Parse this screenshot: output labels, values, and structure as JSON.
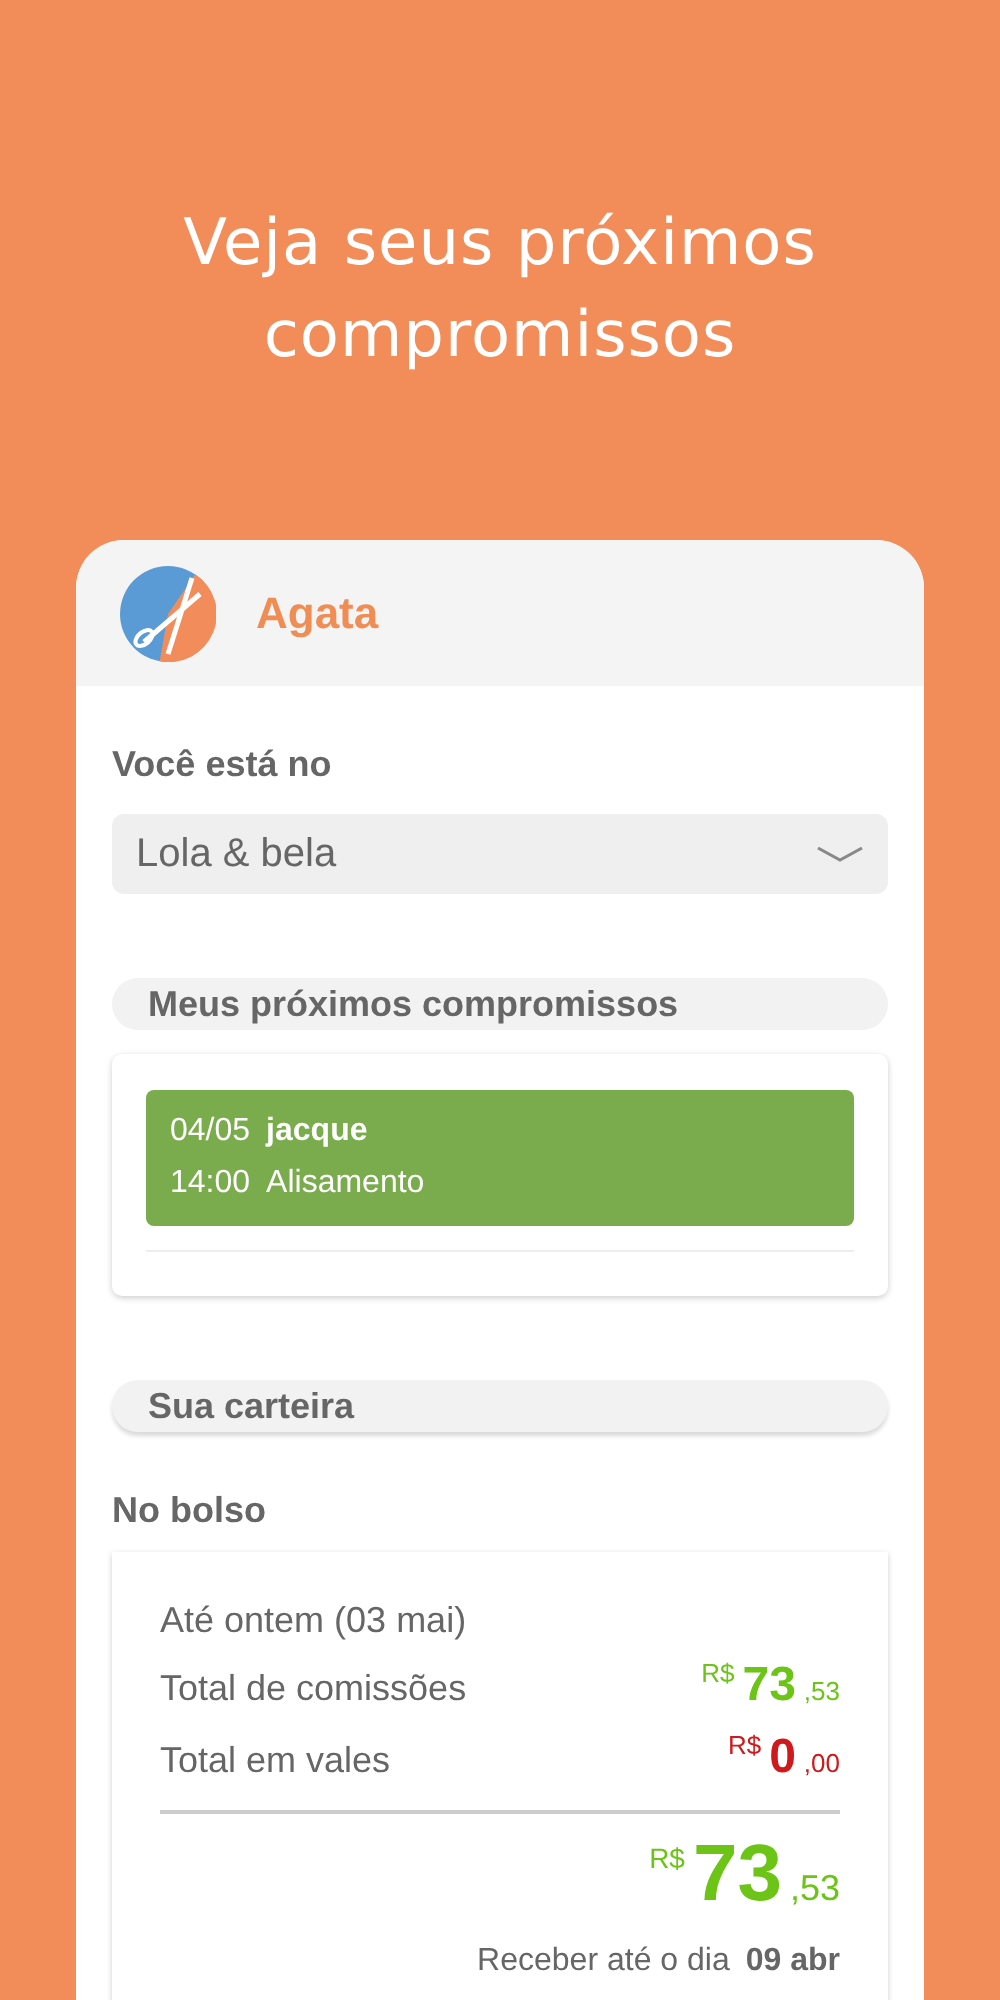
{
  "headline": "Veja seus próximos compromissos",
  "app_header": {
    "user_name": "Agata"
  },
  "location": {
    "label": "Você está no",
    "value": "Lola & bela"
  },
  "appointments": {
    "title": "Meus próximos compromissos",
    "items": [
      {
        "date": "04/05",
        "client": "jacque",
        "time": "14:00",
        "service": "Alisamento",
        "color": "#7aab4c"
      }
    ]
  },
  "wallet": {
    "title": "Sua carteira",
    "subtitle": "No bolso",
    "period": "Até ontem (03 mai)",
    "rows": [
      {
        "label": "Total de comissões",
        "kind": "positive",
        "currency": "R$",
        "integer": "73",
        "cents": ",53"
      },
      {
        "label": "Total em vales",
        "kind": "negative",
        "currency": "R$",
        "integer": "0",
        "cents": ",00"
      }
    ],
    "total": {
      "kind": "positive",
      "currency": "R$",
      "integer": "73",
      "cents": ",53"
    },
    "due_label": "Receber até o dia",
    "due_date": "09 abr"
  }
}
